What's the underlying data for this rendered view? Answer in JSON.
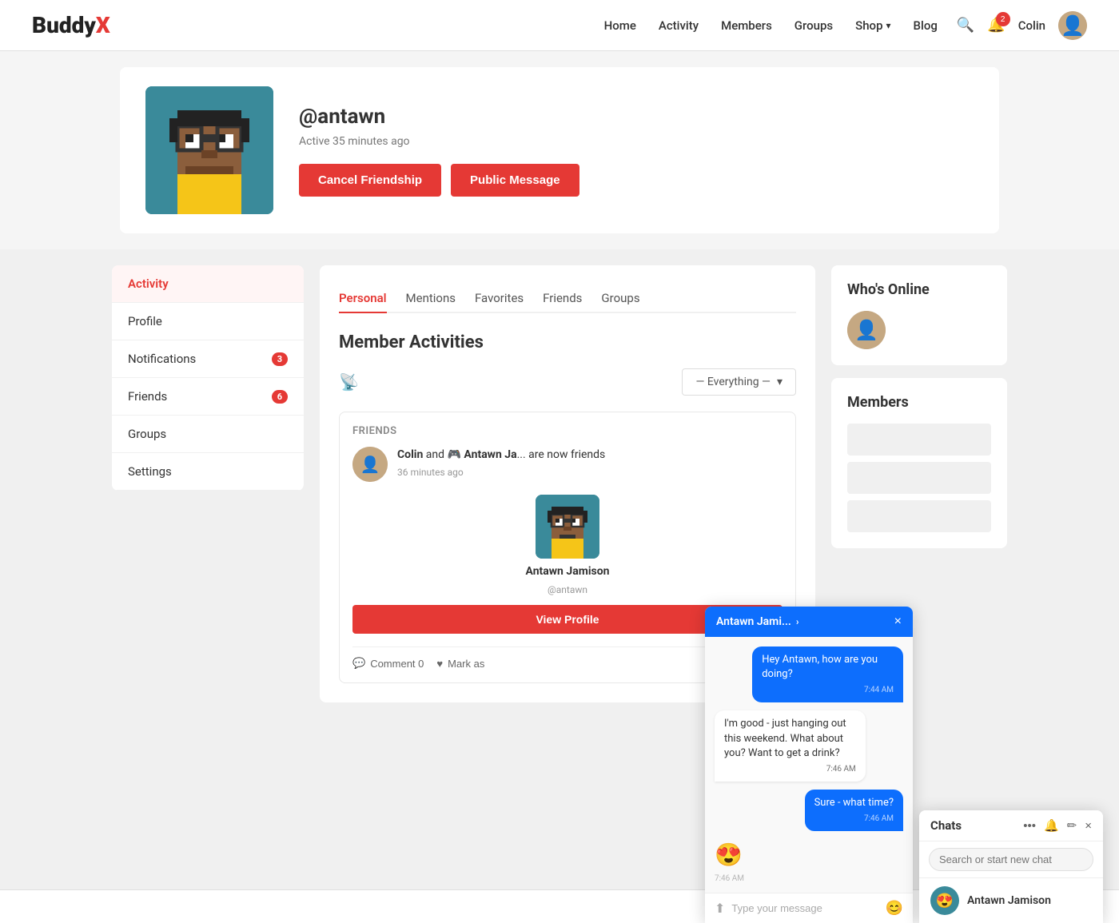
{
  "header": {
    "logo_buddy": "Buddy",
    "logo_x": "X",
    "nav": [
      {
        "label": "Home",
        "href": "#"
      },
      {
        "label": "Activity",
        "href": "#",
        "active": true
      },
      {
        "label": "Members",
        "href": "#"
      },
      {
        "label": "Groups",
        "href": "#"
      },
      {
        "label": "Shop",
        "href": "#",
        "has_dropdown": true
      },
      {
        "label": "Blog",
        "href": "#"
      }
    ],
    "notification_count": "2",
    "user_name": "Colin"
  },
  "profile": {
    "username": "@antawn",
    "status": "Active 35 minutes ago",
    "btn_cancel": "Cancel Friendship",
    "btn_message": "Public Message"
  },
  "sidebar": {
    "items": [
      {
        "label": "Activity",
        "active": true,
        "badge": null
      },
      {
        "label": "Profile",
        "active": false,
        "badge": null
      },
      {
        "label": "Notifications",
        "active": false,
        "badge": "3"
      },
      {
        "label": "Friends",
        "active": false,
        "badge": "6"
      },
      {
        "label": "Groups",
        "active": false,
        "badge": null
      },
      {
        "label": "Settings",
        "active": false,
        "badge": null
      }
    ]
  },
  "activity": {
    "tabs": [
      {
        "label": "Personal",
        "active": true
      },
      {
        "label": "Mentions",
        "active": false
      },
      {
        "label": "Favorites",
        "active": false
      },
      {
        "label": "Friends",
        "active": false
      },
      {
        "label": "Groups",
        "active": false
      }
    ],
    "title": "Member Activities",
    "filter": "— Everything —",
    "card": {
      "section_label": "Friends",
      "text_1": "Colin",
      "text_2": "and",
      "text_3": "Antawn Ja",
      "text_4": "are now",
      "text_5": "friends",
      "time": "36 minutes ago",
      "user_name": "Antawn Jamison",
      "user_handle": "@antawn",
      "view_profile": "View Profile",
      "comment_label": "Comment 0",
      "mark_label": "Mark as"
    }
  },
  "whos_online": {
    "title": "Who's Online"
  },
  "members": {
    "title": "Members"
  },
  "chat_window": {
    "header_name": "Antawn Jami...",
    "messages": [
      {
        "text": "Hey Antawn, how are you doing?",
        "time": "7:44 AM",
        "type": "out"
      },
      {
        "text": "I'm good - just hanging out this weekend. What about you? Want to get a drink?",
        "time": "7:46 AM",
        "type": "in"
      },
      {
        "text": "Sure - what time?",
        "time": "7:46 AM",
        "type": "out"
      },
      {
        "text": "😍",
        "time": "7:46 AM",
        "type": "in",
        "emoji": true
      }
    ],
    "input_placeholder": "Type your message"
  },
  "chats_panel": {
    "title": "Chats",
    "search_placeholder": "Search or start new chat",
    "list": [
      {
        "name": "Antawn Jamison",
        "emoji": "😍"
      }
    ]
  },
  "bottom_bar": {
    "icons": [
      "chat-bubble",
      "person",
      "group"
    ]
  }
}
